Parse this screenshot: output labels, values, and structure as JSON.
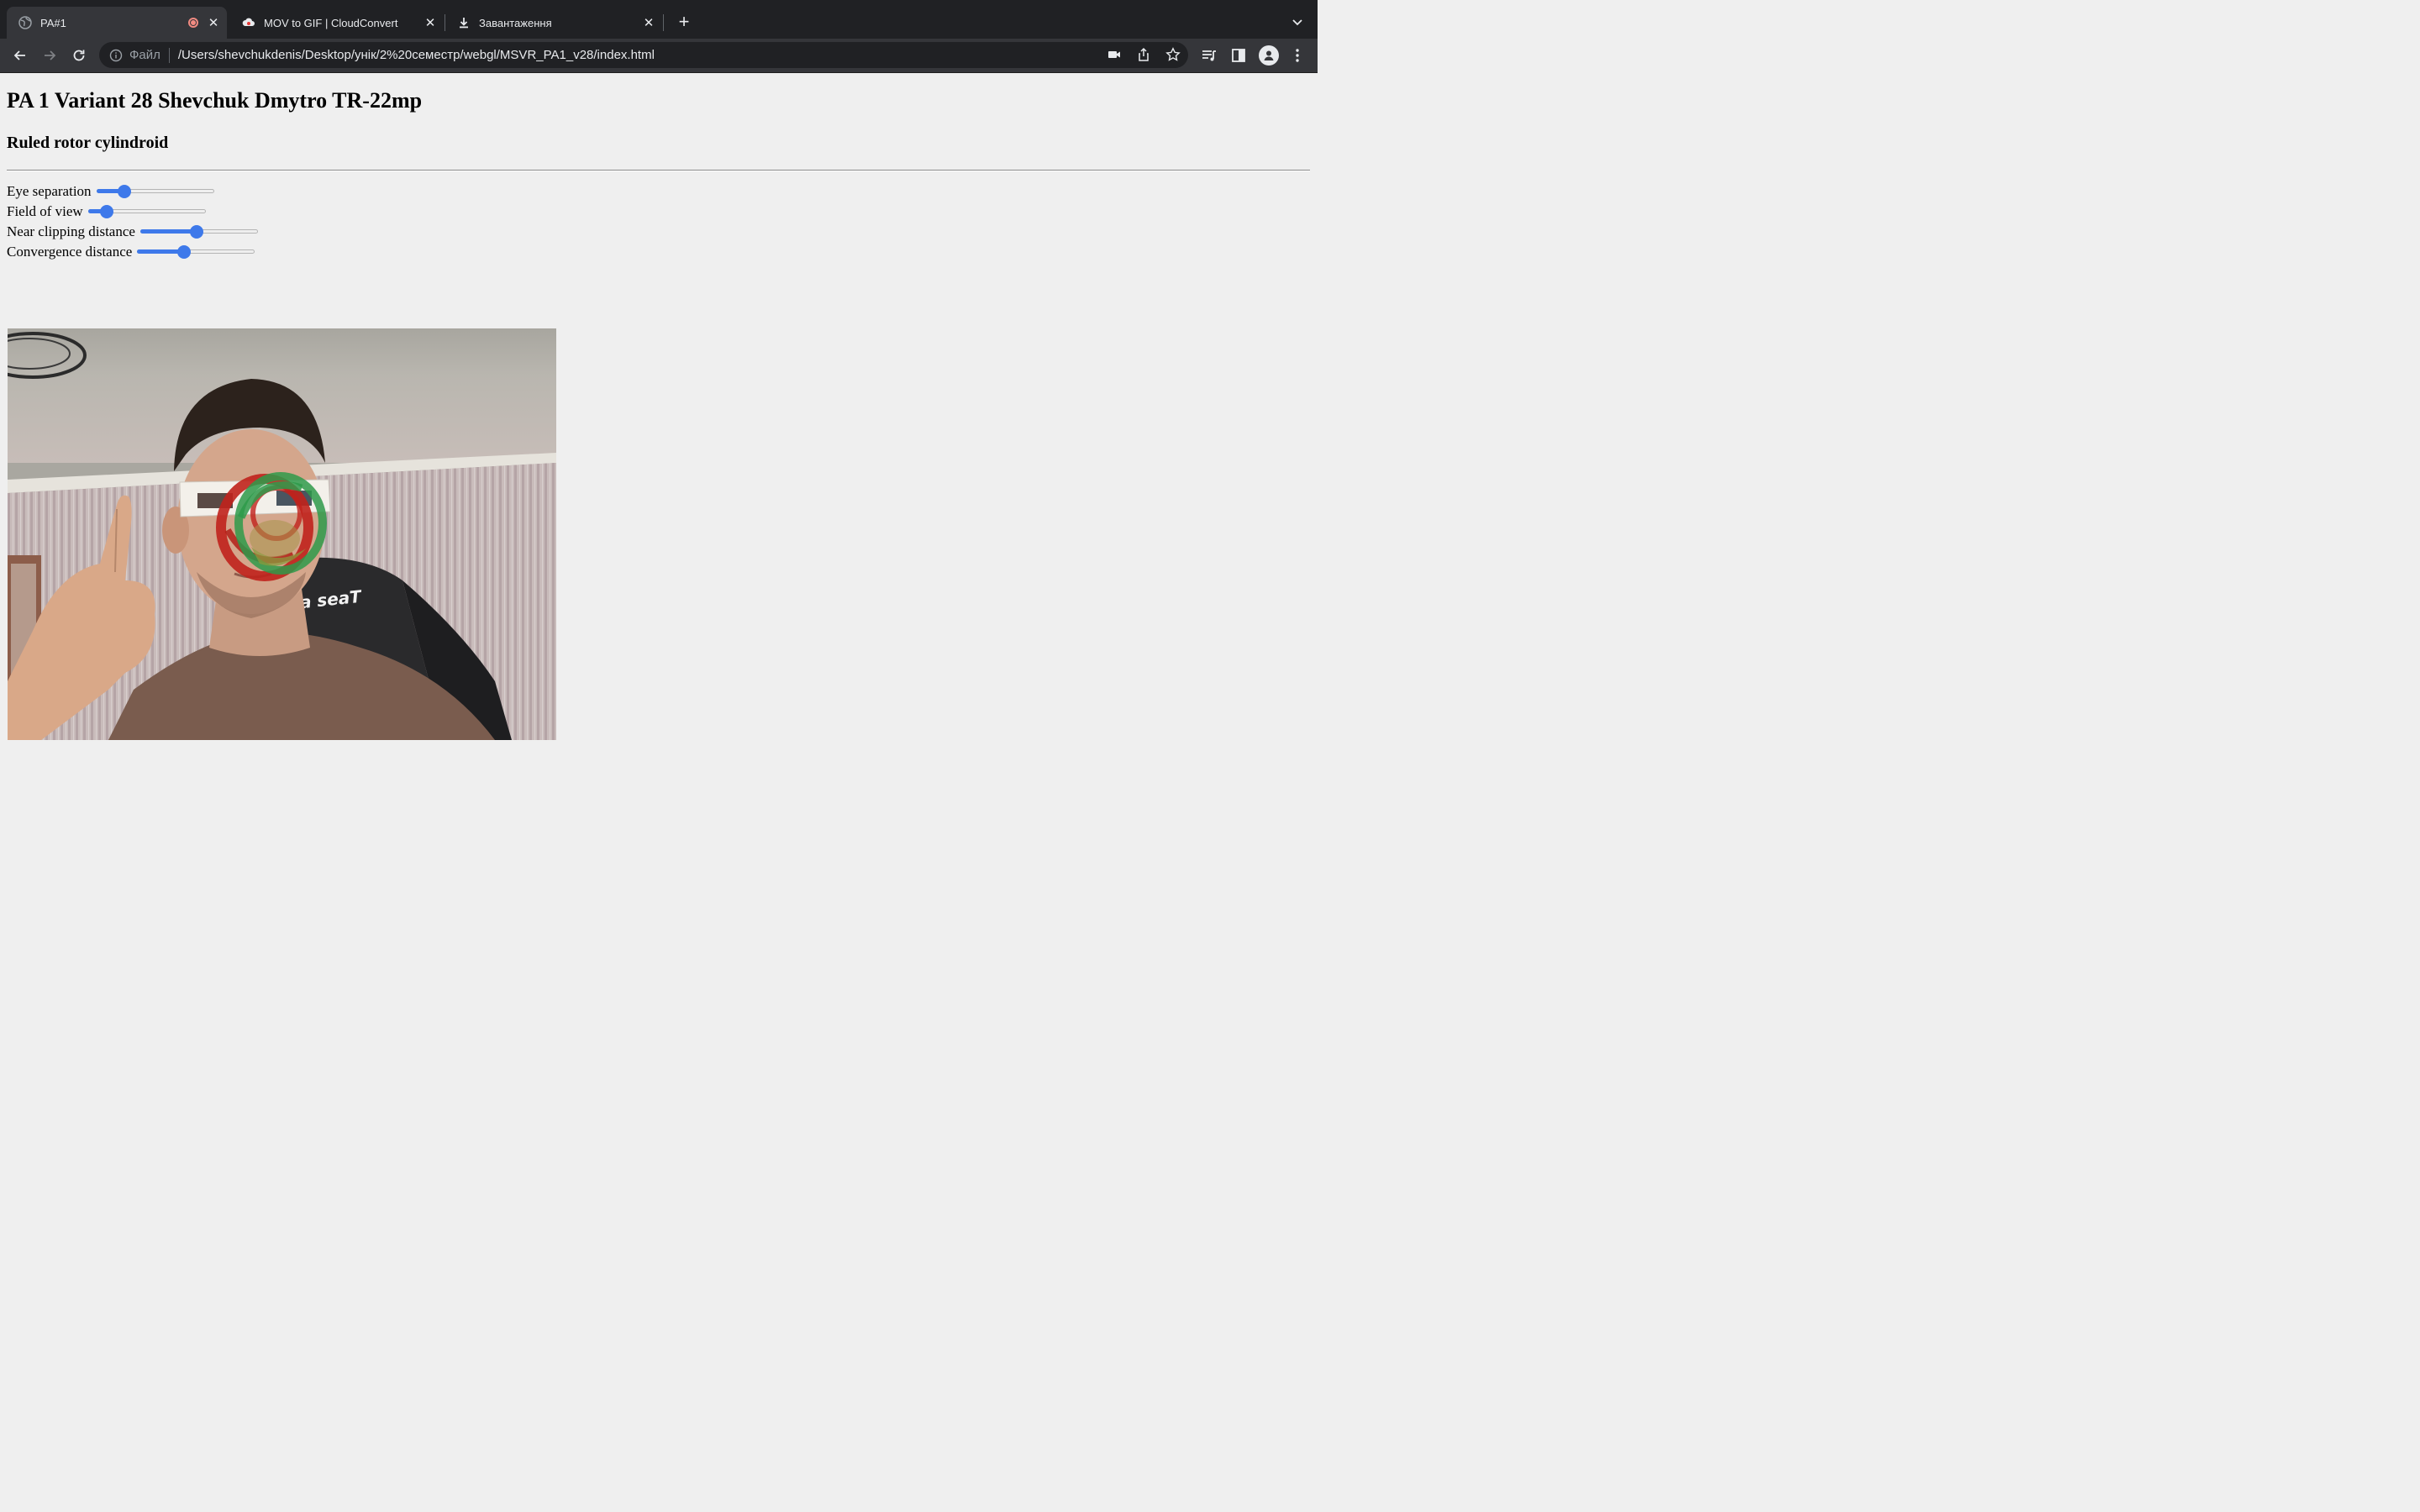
{
  "browser": {
    "tabs": [
      {
        "title": "PA#1",
        "active": true,
        "recording": true
      },
      {
        "title": "MOV to GIF | CloudConvert",
        "active": false
      },
      {
        "title": "Завантаження",
        "active": false
      }
    ],
    "omnibox": {
      "scheme_label": "Файл",
      "url": "/Users/shevchukdenis/Desktop/унік/2%20семестр/webgl/MSVR_PA1_v28/index.html"
    }
  },
  "page": {
    "title": "PA 1 Variant 28 Shevchuk Dmytro TR-22mp",
    "subtitle": "Ruled rotor cylindroid",
    "controls": [
      {
        "label": "Eye separation",
        "value_fraction": 0.24
      },
      {
        "label": "Field of view",
        "value_fraction": 0.16
      },
      {
        "label": "Near clipping distance",
        "value_fraction": 0.48
      },
      {
        "label": "Convergence distance",
        "value_fraction": 0.4
      }
    ],
    "video": {
      "chair_text": "a seaT"
    }
  },
  "colors": {
    "accent": "#3e79ea",
    "tab_bg": "#202124",
    "toolbar_bg": "#35363a",
    "page_bg": "#efefef",
    "anaglyph_red": "#c0221c",
    "anaglyph_green": "#2e9a4a"
  }
}
